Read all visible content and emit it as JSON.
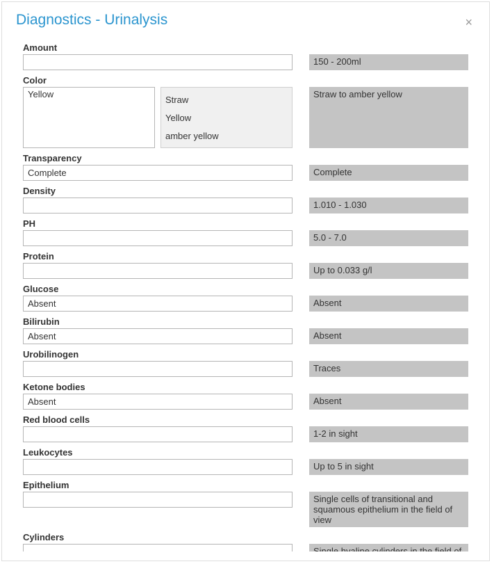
{
  "dialog": {
    "title": "Diagnostics - Urinalysis",
    "close_icon": "×"
  },
  "fields": {
    "amount": {
      "label": "Amount",
      "value": "",
      "reference": "150 - 200ml"
    },
    "color": {
      "label": "Color",
      "value": "Yellow",
      "options": [
        "Straw",
        "Yellow",
        "amber yellow"
      ],
      "reference": "Straw to amber yellow"
    },
    "transparency": {
      "label": "Transparency",
      "value": "Complete",
      "reference": "Complete"
    },
    "density": {
      "label": "Density",
      "value": "",
      "reference": "1.010 - 1.030"
    },
    "ph": {
      "label": "PH",
      "value": "",
      "reference": "5.0 - 7.0"
    },
    "protein": {
      "label": "Protein",
      "value": "",
      "reference": "Up to 0.033 g/l"
    },
    "glucose": {
      "label": "Glucose",
      "value": "Absent",
      "reference": "Absent"
    },
    "bilirubin": {
      "label": "Bilirubin",
      "value": "Absent",
      "reference": "Absent"
    },
    "urobilinogen": {
      "label": "Urobilinogen",
      "value": "",
      "reference": "Traces"
    },
    "ketone_bodies": {
      "label": "Ketone bodies",
      "value": "Absent",
      "reference": "Absent"
    },
    "red_blood_cells": {
      "label": "Red blood cells",
      "value": "",
      "reference": "1-2 in sight"
    },
    "leukocytes": {
      "label": "Leukocytes",
      "value": "",
      "reference": "Up to 5 in sight"
    },
    "epithelium": {
      "label": "Epithelium",
      "value": "",
      "reference": "Single cells of transitional and squamous epithelium in the field of view"
    },
    "cylinders": {
      "label": "Cylinders",
      "value": "",
      "reference": "Single hyaline cylinders in the field of view"
    }
  }
}
